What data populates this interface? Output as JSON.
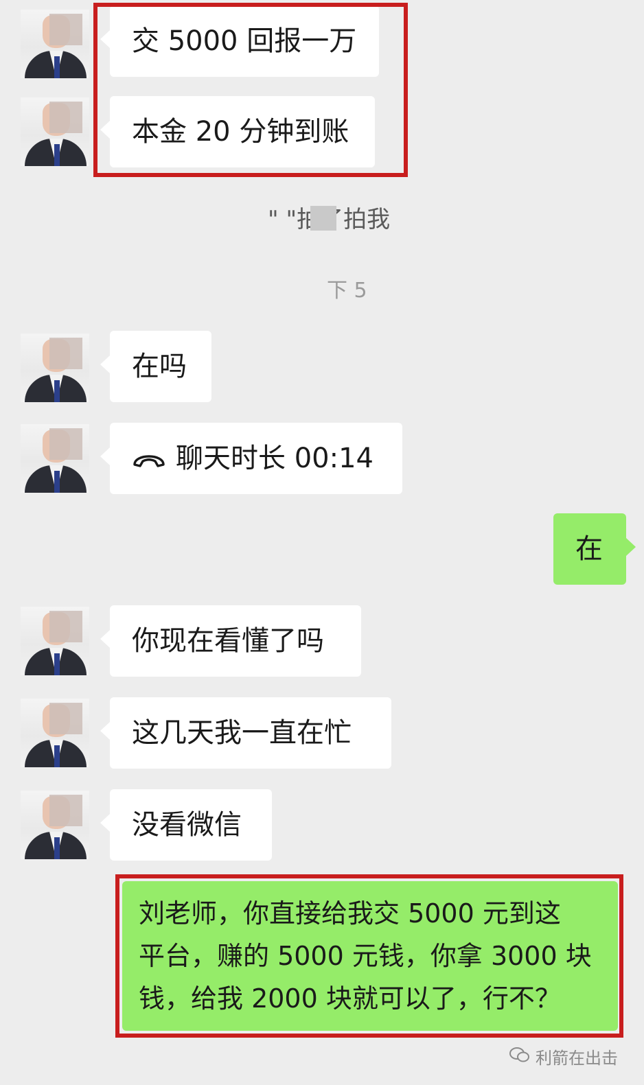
{
  "messages": [
    {
      "side": "left",
      "text": "交 5000 回报一万"
    },
    {
      "side": "left",
      "text": "本金 20 分钟到账"
    },
    {
      "side": "system",
      "text": "\"   \"拍了拍我"
    },
    {
      "side": "time",
      "text": "下    5"
    },
    {
      "side": "left",
      "text": "在吗"
    },
    {
      "side": "left",
      "type": "call",
      "icon": "phone-hangup-icon",
      "text": "聊天时长 00:14"
    },
    {
      "side": "right",
      "text": "在"
    },
    {
      "side": "left",
      "text": "你现在看懂了吗"
    },
    {
      "side": "left",
      "text": "这几天我一直在忙"
    },
    {
      "side": "left",
      "text": "没看微信"
    },
    {
      "side": "right",
      "text": "刘老师，你直接给我交 5000 元到这平台，赚的 5000 元钱，你拿 3000 块钱，给我 2000 块就可以了，行不？",
      "lines": [
        "刘老师，你直接给我交 5000 元到这",
        "平台，赚的 5000 元钱，你拿 3000 块",
        "钱，给我 2000 块就可以了，行不？"
      ]
    }
  ],
  "watermark": "利箭在出击",
  "colors": {
    "background": "#ededed",
    "incoming": "#ffffff",
    "outgoing": "#95ec69",
    "highlight": "#c81e1e"
  }
}
